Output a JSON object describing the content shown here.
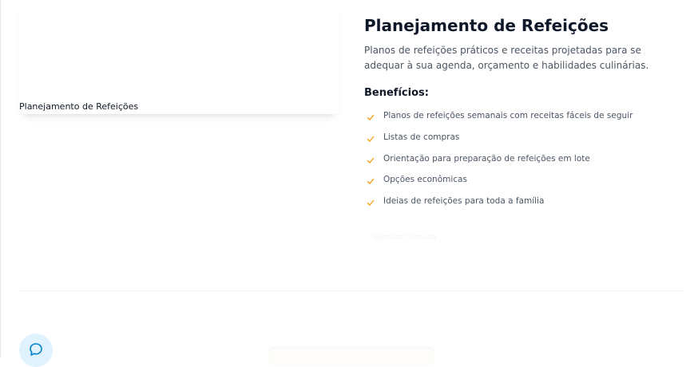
{
  "image": {
    "alt": "Planejamento de Refeições"
  },
  "service": {
    "title": "Planejamento de Refeições",
    "description": "Planos de refeições práticos e receitas projetadas para se adequar à sua agenda, orçamento e habilidades culinárias.",
    "benefits_title": "Benefícios:",
    "benefits": [
      "Planos de refeições semanais com receitas fáceis de seguir",
      "Listas de compras",
      "Orientação para preparação de refeições em lote",
      "Opções econômicas",
      "Ideias de refeições para toda a família"
    ],
    "cta_label": "Agendar Consulta"
  },
  "colors": {
    "accent": "#f59e0b",
    "title": "#0f172a",
    "body_text": "#4b5563",
    "chat_bg": "#e0f2fe",
    "chat_icon": "#0284c7"
  },
  "icons": {
    "benefit": "check-icon",
    "chat": "chat-bubble-icon"
  }
}
